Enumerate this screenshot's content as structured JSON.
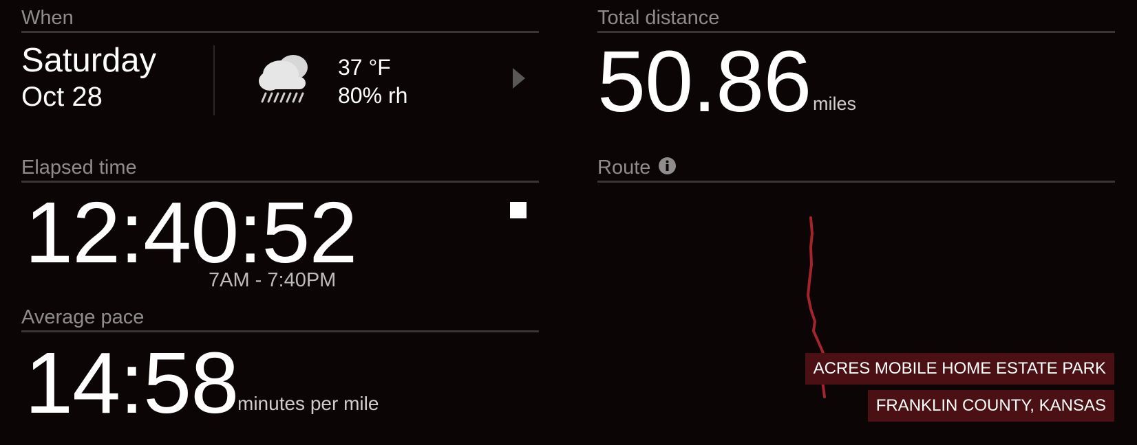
{
  "when": {
    "title": "When",
    "day": "Saturday",
    "date": "Oct 28",
    "weather": {
      "icon": "rain-cloud-icon",
      "temperature": "37 °F",
      "humidity": "80% rh"
    },
    "next_icon": "chevron-right-icon"
  },
  "distance": {
    "title": "Total distance",
    "value": "50.86",
    "unit": "miles"
  },
  "elapsed": {
    "title": "Elapsed time",
    "value": "12:40:52",
    "range": "7AM - 7:40PM",
    "stop_icon": "stop-icon"
  },
  "pace": {
    "title": "Average pace",
    "value": "14:58",
    "unit": "minutes per mile"
  },
  "route": {
    "title": "Route",
    "info_icon": "info-icon",
    "line_color": "#a3242c",
    "places": [
      "ACRES MOBILE HOME ESTATE PARK",
      "FRANKLIN COUNTY, KANSAS"
    ]
  },
  "colors": {
    "background": "#0b0506",
    "label_bg": "#4a1014",
    "section_title": "#8e8c8c"
  }
}
